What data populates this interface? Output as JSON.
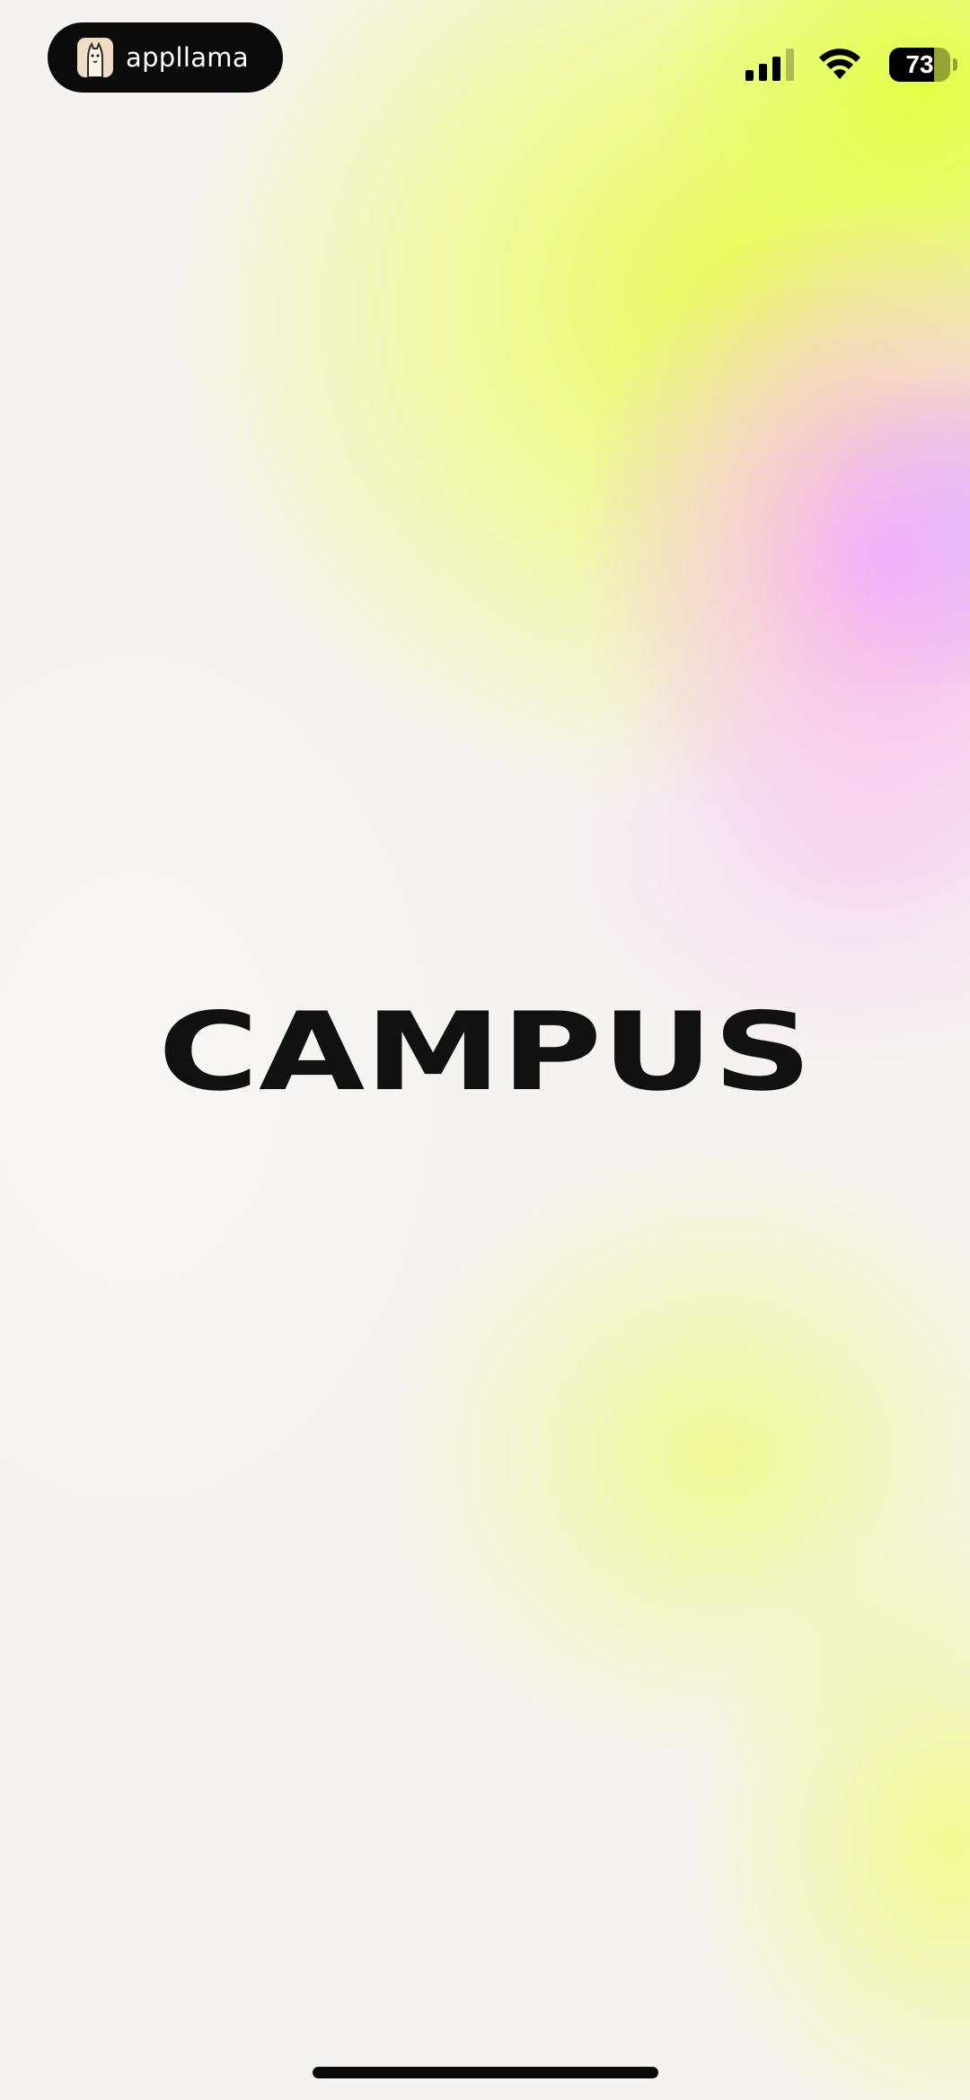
{
  "status_bar": {
    "app_badge": "appllama",
    "battery_percent": "73",
    "battery_level": 0.73,
    "signal_bars_active": 3,
    "signal_bars_total": 4
  },
  "splash": {
    "logo_text": "CAMPUS"
  },
  "colors": {
    "background": "#f5f3f1",
    "gradient_yellow": "#e6ff50",
    "gradient_pink": "#faaafa",
    "logo": "#111111"
  },
  "icons": [
    "llama-icon",
    "signal-icon",
    "wifi-icon",
    "battery-icon"
  ]
}
